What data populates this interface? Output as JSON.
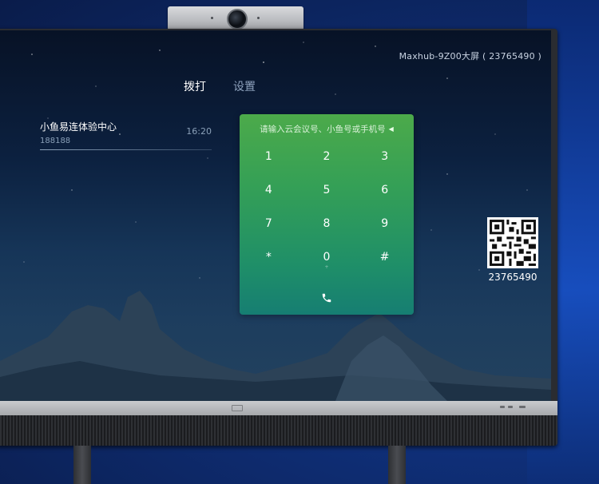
{
  "device": {
    "label": "Maxhub-9Z00大屏 ( 23765490 )"
  },
  "tabs": [
    {
      "label": "拨打",
      "active": true
    },
    {
      "label": "设置",
      "active": false
    }
  ],
  "recent_calls": [
    {
      "name": "小鱼易连体验中心",
      "number": "188188",
      "time": "16:20"
    }
  ],
  "dialpad": {
    "placeholder": "请输入云会议号、小鱼号或手机号",
    "keys": [
      {
        "label": "1",
        "sub": ""
      },
      {
        "label": "2",
        "sub": ""
      },
      {
        "label": "3",
        "sub": ""
      },
      {
        "label": "4",
        "sub": ""
      },
      {
        "label": "5",
        "sub": ""
      },
      {
        "label": "6",
        "sub": ""
      },
      {
        "label": "7",
        "sub": ""
      },
      {
        "label": "8",
        "sub": ""
      },
      {
        "label": "9",
        "sub": ""
      },
      {
        "label": "*",
        "sub": ""
      },
      {
        "label": "0",
        "sub": "+"
      },
      {
        "label": "#",
        "sub": ""
      }
    ],
    "call_icon": "phone-icon"
  },
  "qr": {
    "number": "23765490",
    "icon": "qr-code-icon"
  },
  "colors": {
    "dialpad_top": "#4caa4a",
    "dialpad_bottom": "#167e72",
    "sky": "#0c2140"
  }
}
